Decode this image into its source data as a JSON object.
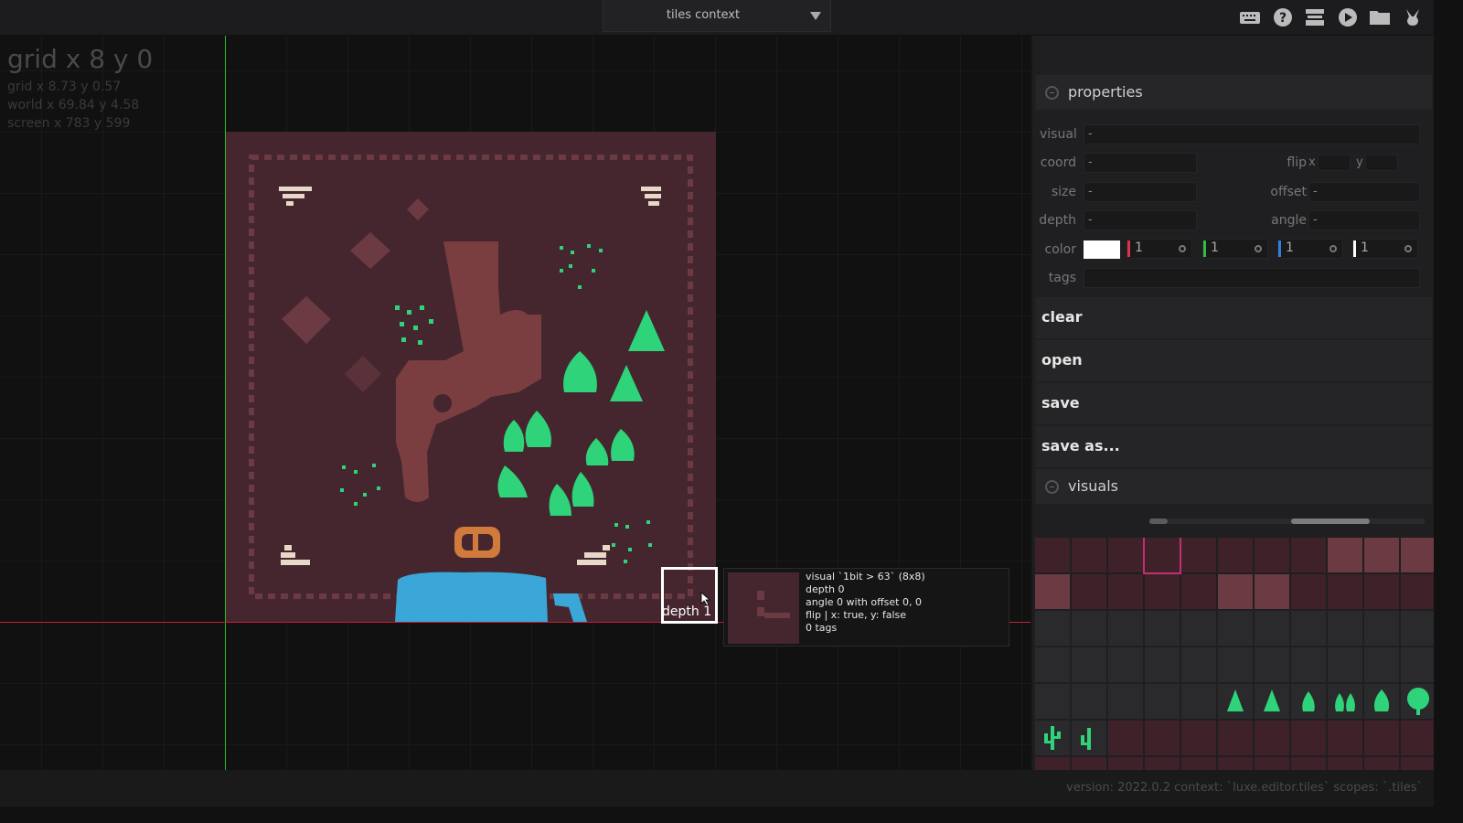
{
  "context": {
    "label": "tiles context"
  },
  "top_icons": [
    "keyboard-icon",
    "help-icon",
    "stamp-icon",
    "play-icon",
    "folder-icon",
    "rabbit-icon"
  ],
  "viewport": {
    "grid_big": "grid x 8 y 0",
    "grid_fine": "grid x 8.73 y 0.57",
    "world": "world x 69.84 y 4.58",
    "screen": "screen x 783 y 599"
  },
  "selection": {
    "depth_label": "depth 1"
  },
  "tooltip": {
    "line1": "visual `1bit > 63` (8x8)",
    "line2": "depth 0",
    "line3": "angle 0 with offset 0, 0",
    "line4": "flip | x: true, y: false",
    "line5": "0 tags"
  },
  "colors": {
    "map_bg": "#45262f",
    "wall": "#6b3a42",
    "dirt": "#7a3e40",
    "plant": "#2fd47a",
    "water": "#3aa7d8",
    "bone": "#e8d8c8",
    "pot": "#d07a3c"
  },
  "properties": {
    "title": "properties",
    "visual_label": "visual",
    "visual_value": "-",
    "coord_label": "coord",
    "coord_value": "-",
    "flip_label": "flip",
    "flip_x": "x",
    "flip_y": "y",
    "size_label": "size",
    "size_value": "-",
    "offset_label": "offset",
    "offset_value": "-",
    "depth_label": "depth",
    "depth_value": "-",
    "angle_label": "angle",
    "angle_value": "-",
    "color_label": "color",
    "color_r": "1",
    "color_g": "1",
    "color_b": "1",
    "color_a": "1",
    "tags_label": "tags"
  },
  "buttons": {
    "clear": "clear",
    "open": "open",
    "save": "save",
    "save_as": "save as..."
  },
  "visuals": {
    "title": "visuals"
  },
  "status": "version: 2022.0.2 context: `luxe.editor.tiles` scopes: `.tiles`"
}
